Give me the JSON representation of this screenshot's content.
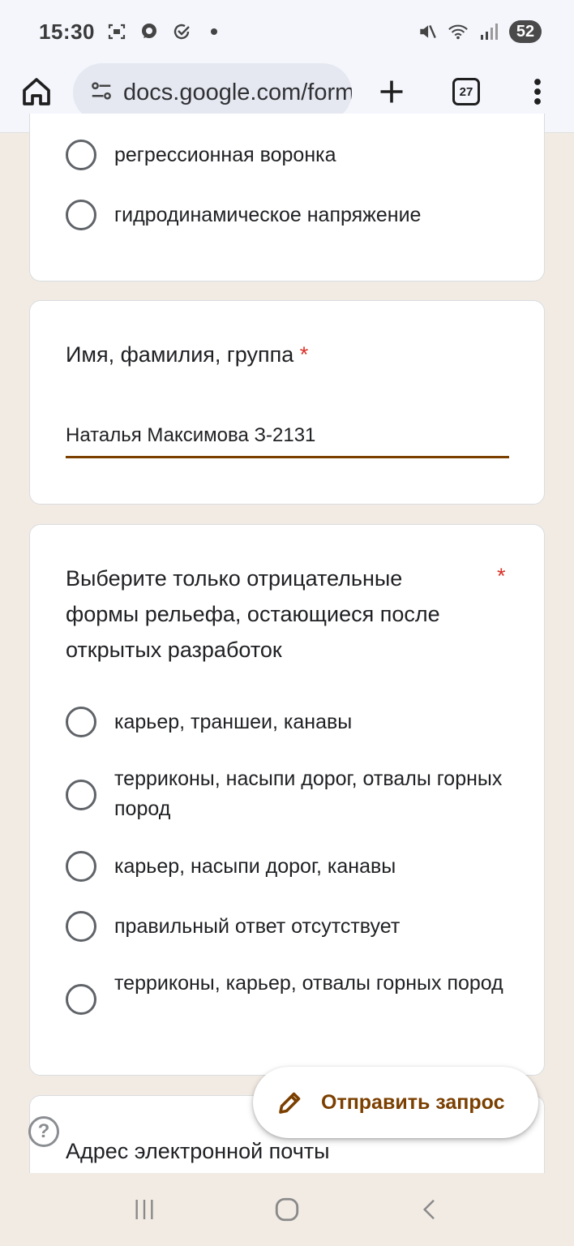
{
  "status_bar": {
    "time": "15:30",
    "battery": "52",
    "icons": [
      "screenshot-icon",
      "chat-icon",
      "check-circle-icon",
      "dot-icon",
      "mute-icon",
      "wifi-icon",
      "signal-icon"
    ]
  },
  "toolbar": {
    "url": "docs.google.com/forms",
    "tabs_count": "27"
  },
  "question1": {
    "options": [
      "регрессионная воронка",
      "гидродинамическое напряжение"
    ]
  },
  "question2": {
    "title": "Имя, фамилия, группа",
    "required_mark": "*",
    "answer": "Наталья Максимова З-2131"
  },
  "question3": {
    "title": "Выберите только отрицательные формы рельефа, остающиеся после открытых разработок",
    "required_mark": "*",
    "options": [
      "карьер, траншеи, канавы",
      "терриконы, насыпи дорог, отвалы горных пород",
      "карьер, насыпи дорог, канавы",
      "правильный ответ отсутствует",
      "терриконы, карьер, отвалы горных пород"
    ]
  },
  "question4": {
    "title": "Адрес электронной почты"
  },
  "fab": {
    "label": "Отправить запрос"
  },
  "help": {
    "glyph": "?"
  },
  "colors": {
    "accent": "#7b3f00",
    "required": "#d93025",
    "page_bg": "#f2ebe4"
  }
}
